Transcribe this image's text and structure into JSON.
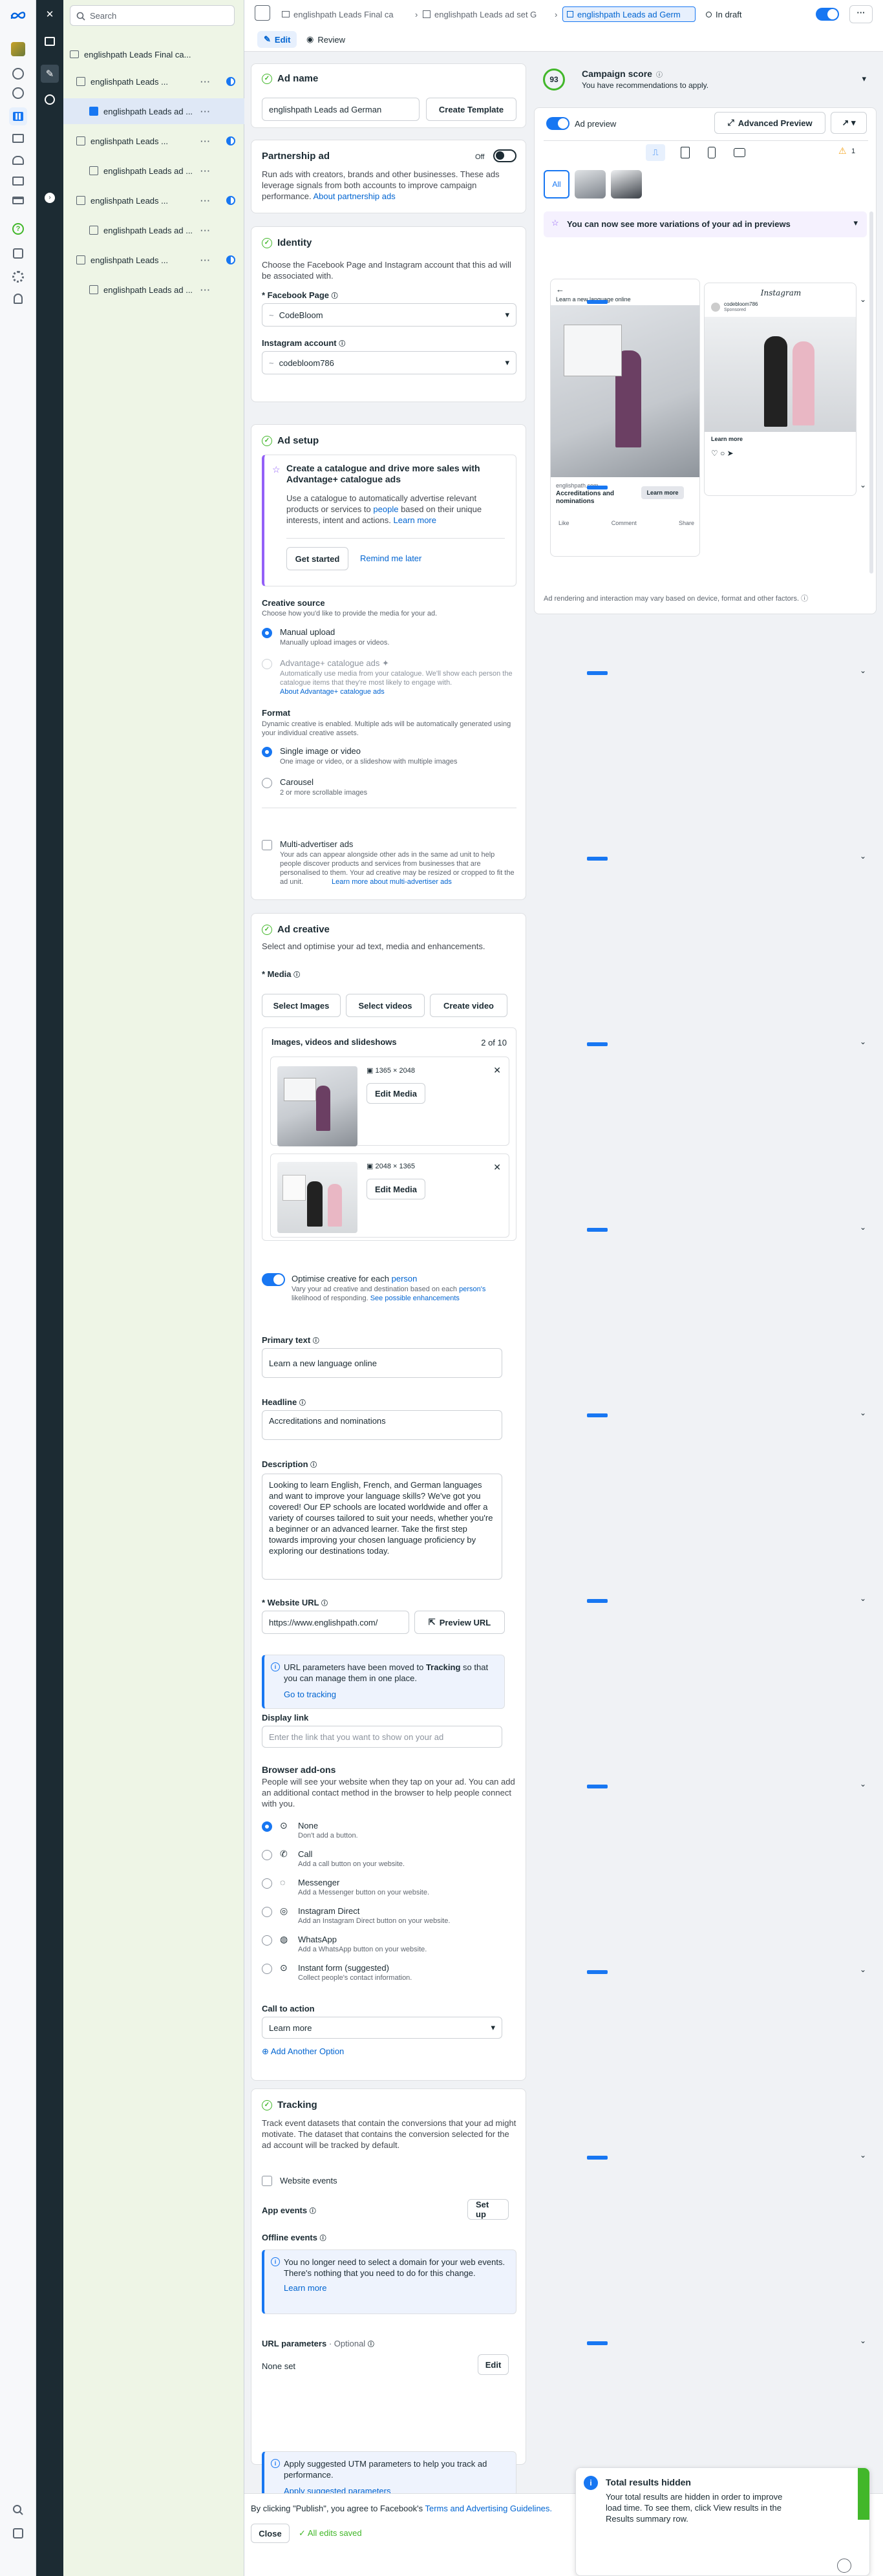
{
  "tree": {
    "search_placeholder": "Search",
    "campaign": "englishpath Leads Final ca...",
    "items": [
      {
        "label": "englishpath Leads ...",
        "type": "adset"
      },
      {
        "label": "englishpath Leads ad ...",
        "type": "ad"
      },
      {
        "label": "englishpath Leads ...",
        "type": "adset"
      },
      {
        "label": "englishpath Leads ad ...",
        "type": "ad"
      },
      {
        "label": "englishpath Leads ...",
        "type": "adset"
      },
      {
        "label": "englishpath Leads ad ...",
        "type": "ad"
      },
      {
        "label": "englishpath Leads ...",
        "type": "adset"
      },
      {
        "label": "englishpath Leads ad ...",
        "type": "ad"
      }
    ]
  },
  "topbar": {
    "crumb1": "englishpath Leads Final ca",
    "crumb2": "englishpath Leads ad set G",
    "crumb3": "englishpath Leads ad Germ",
    "status": "In draft",
    "tab_edit": "Edit",
    "tab_review": "Review"
  },
  "ad_name": {
    "title": "Ad name",
    "value": "englishpath Leads ad  German",
    "create_template": "Create Template"
  },
  "partnership": {
    "title": "Partnership ad",
    "toggle_label": "Off",
    "desc": "Run ads with creators, brands and other businesses. These ads leverage signals from both accounts to improve campaign performance.",
    "link": "About partnership ads"
  },
  "identity": {
    "title": "Identity",
    "desc": "Choose the Facebook Page and Instagram account that this ad will be associated with.",
    "fb_label": "* Facebook Page",
    "fb_value": "CodeBloom",
    "ig_label": "Instagram account",
    "ig_value": "codebloom786"
  },
  "ad_setup": {
    "title": "Ad setup",
    "catalog_title": "Create a catalogue and drive more sales with Advantage+ catalogue ads",
    "catalog_desc_1": "Use a catalogue to automatically advertise relevant products or services to",
    "catalog_desc_people": "people",
    "catalog_desc_2": "based on their unique interests, intent and actions.",
    "learn_more": "Learn more",
    "get_started": "Get started",
    "remind": "Remind me later",
    "cs_title": "Creative source",
    "cs_desc": "Choose how you'd like to provide the media for your ad.",
    "manual": "Manual upload",
    "manual_desc": "Manually upload images or videos.",
    "adv_cat": "Advantage+ catalogue ads",
    "adv_cat_desc": "Automatically use media from your catalogue. We'll show each person the catalogue items that they're most likely to engage with.",
    "adv_cat_link": "About Advantage+ catalogue ads",
    "format_title": "Format",
    "format_desc": "Dynamic creative is enabled. Multiple ads will be automatically generated using your individual creative assets.",
    "single": "Single image or video",
    "single_desc": "One image or video, or a slideshow with multiple images",
    "carousel": "Carousel",
    "carousel_desc": "2 or more scrollable images",
    "multi": "Multi-advertiser ads",
    "multi_desc": "Your ads can appear alongside other ads in the same ad unit to help people discover products and services from businesses that are personalised to them. Your ad creative may be resized or cropped to fit the ad unit.",
    "multi_link": "Learn more about multi-advertiser ads"
  },
  "creative": {
    "title": "Ad creative",
    "desc": "Select and optimise your ad text, media and enhancements.",
    "media_label": "* Media",
    "select_images": "Select Images",
    "select_videos": "Select videos",
    "create_video": "Create video",
    "list_title": "Images, videos and slideshows",
    "count": "2 of 10",
    "m1_dim": "1365 × 2048",
    "m2_dim": "2048 × 1365",
    "edit_media": "Edit Media",
    "optimise": "Optimise creative for each",
    "optimise_person": "person",
    "optimise_desc_1": "Vary your ad creative and destination based on each",
    "optimise_desc_person": "person's",
    "optimise_desc_2": "likelihood of responding.",
    "optimise_link": "See possible enhancements",
    "primary_label": "Primary text",
    "primary_value": "Learn a new language online",
    "headline_label": "Headline",
    "headline_value": "Accreditations and nominations",
    "desc_label": "Description",
    "desc_value": "Looking to learn English, French, and German languages and want to improve your language skills? We've got you covered! Our EP schools are located worldwide and offer a variety of courses tailored to suit your needs, whether you're a beginner or an advanced learner. Take the first step towards improving your chosen language proficiency by exploring our destinations today.",
    "url_label": "* Website URL",
    "url_value": "https://www.englishpath.com/",
    "preview_url": "Preview URL",
    "url_info_1": "URL parameters have been moved to",
    "url_info_bold": "Tracking",
    "url_info_2": "so that you can manage them in one place.",
    "go_tracking": "Go to tracking",
    "display_label": "Display link",
    "display_ph": "Enter the link that you want to show on your ad",
    "addons_title": "Browser add-ons",
    "addons_desc": "People will see your website when they tap on your ad. You can add an additional contact method in the browser to help people connect with you.",
    "addons": [
      {
        "t": "None",
        "d": "Don't add a button."
      },
      {
        "t": "Call",
        "d": "Add a call button on your website."
      },
      {
        "t": "Messenger",
        "d": "Add a Messenger button on your website."
      },
      {
        "t": "Instagram Direct",
        "d": "Add an Instagram Direct button on your website."
      },
      {
        "t": "WhatsApp",
        "d": "Add a WhatsApp button on your website."
      },
      {
        "t": "Instant form (suggested)",
        "d": "Collect people's contact information."
      }
    ],
    "cta_label": "Call to action",
    "cta_value": "Learn more",
    "add_option": "Add Another Option"
  },
  "tracking": {
    "title": "Tracking",
    "desc": "Track event datasets that contain the conversions that your ad might motivate. The dataset that contains the conversion selected for the ad account will be tracked by default.",
    "website": "Website events",
    "app": "App events",
    "setup": "Set up",
    "offline": "Offline events",
    "offline_info": "You no longer need to select a domain for your web events. There's nothing that you need to do for this change.",
    "learn_more": "Learn more",
    "url_params": "URL parameters",
    "optional": "· Optional",
    "none_set": "None set",
    "edit": "Edit",
    "utm_info": "Apply suggested UTM parameters to help you track ad performance.",
    "apply": "Apply suggested parameters"
  },
  "footer": {
    "terms_1": "By clicking \"Publish\", you agree to Facebook's",
    "terms_link": "Terms and Advertising Guidelines.",
    "close": "Close",
    "saved": "All edits saved"
  },
  "preview": {
    "score": "93",
    "score_title": "Campaign score",
    "score_desc": "You have recommendations to apply.",
    "ad_preview": "Ad preview",
    "advanced": "Advanced Preview",
    "all": "All",
    "warn_count": "1",
    "variations": "You can now see more variations of your ad in previews",
    "fb_post_text": "Learn a new language online",
    "fb_domain": "englishpath.com",
    "fb_headline": "Accreditations and nominations",
    "learn_btn": "Learn more",
    "fb_like": "Like",
    "fb_comment": "Comment",
    "fb_share": "Share",
    "ig_brand": "Instagram",
    "ig_user": "codebloom786",
    "ig_sponsored": "Sponsored",
    "ig_learn": "Learn more",
    "disclaimer": "Ad rendering and interaction may vary based on device, format and other factors."
  },
  "toast": {
    "title": "Total results hidden",
    "body": "Your total results are hidden in order to improve load time. To see them, click View results in the Results summary row."
  }
}
